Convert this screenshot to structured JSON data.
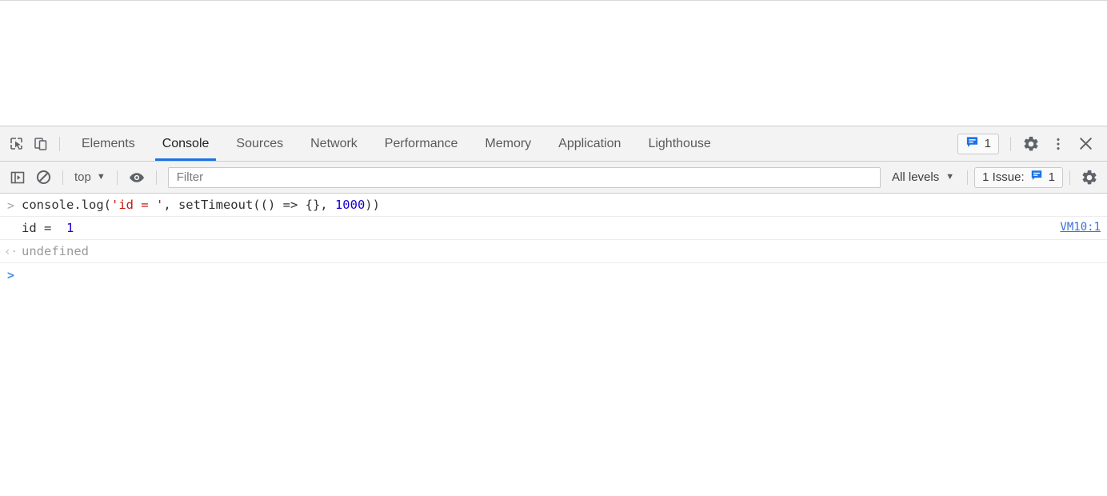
{
  "page": {
    "viewport_blank": ""
  },
  "devtools": {
    "toolbar_icons": {
      "inspect_element": "inspect-cursor-icon",
      "device_toolbar": "device-toggle-icon"
    },
    "tabs": [
      {
        "label": "Elements",
        "active": false
      },
      {
        "label": "Console",
        "active": true
      },
      {
        "label": "Sources",
        "active": false
      },
      {
        "label": "Network",
        "active": false
      },
      {
        "label": "Performance",
        "active": false
      },
      {
        "label": "Memory",
        "active": false
      },
      {
        "label": "Application",
        "active": false
      },
      {
        "label": "Lighthouse",
        "active": false
      }
    ],
    "right_controls": {
      "issues_badge_icon": "issue-message-icon",
      "issues_badge_count": "1",
      "settings_icon": "gear-icon",
      "more_icon": "kebab-menu-icon",
      "close_icon": "close-icon"
    },
    "accent_color": "#1a73e8"
  },
  "console_toolbar": {
    "sidebar_toggle_icon": "console-sidebar-icon",
    "clear_console_icon": "clear-console-icon",
    "context": {
      "label": "top",
      "caret": "▼"
    },
    "live_expression_icon": "eye-icon",
    "filter": {
      "value": "",
      "placeholder": "Filter"
    },
    "levels": {
      "label": "All levels",
      "caret": "▼"
    },
    "issue_counter": {
      "text": "1 Issue:",
      "icon": "issue-message-icon",
      "count": "1"
    },
    "settings_icon": "gear-icon"
  },
  "console": {
    "messages": [
      {
        "type": "input",
        "gutter": ">",
        "tokens": [
          {
            "text": "console.log(",
            "kind": "plain"
          },
          {
            "text": "'id = '",
            "kind": "string"
          },
          {
            "text": ", setTimeout(() => {}, ",
            "kind": "plain"
          },
          {
            "text": "1000",
            "kind": "number"
          },
          {
            "text": "))",
            "kind": "plain"
          }
        ],
        "source": ""
      },
      {
        "type": "log",
        "gutter": "",
        "tokens": [
          {
            "text": "id = ",
            "kind": "plain"
          },
          {
            "text": " 1",
            "kind": "number"
          }
        ],
        "source": "VM10:1"
      },
      {
        "type": "result",
        "gutter": "‹·",
        "tokens": [
          {
            "text": "undefined",
            "kind": "result"
          }
        ],
        "source": ""
      },
      {
        "type": "prompt",
        "gutter": ">",
        "tokens": [],
        "source": ""
      }
    ]
  },
  "colors": {
    "string_token": "#c41a16",
    "number_token": "#1c00cf",
    "link": "#3b70d6",
    "issue_blue": "#1a73e8"
  }
}
